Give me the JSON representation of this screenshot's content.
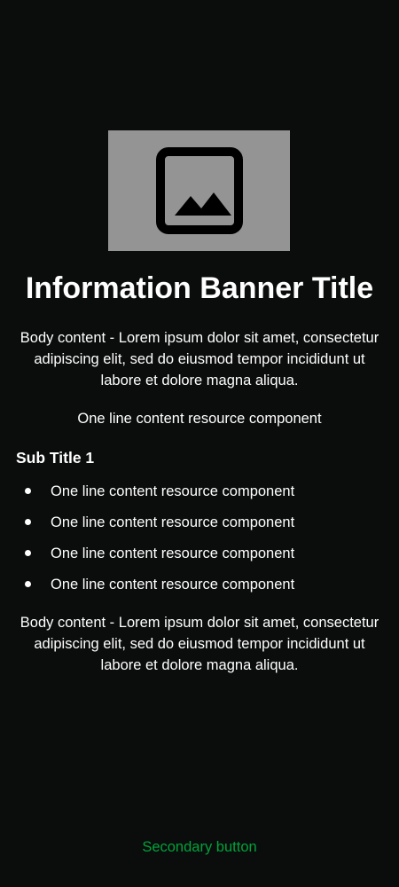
{
  "banner": {
    "image_icon": "image-placeholder-icon",
    "title": "Information Banner Title",
    "body_1": "Body content - Lorem ipsum dolor sit amet, consectetur adipiscing elit, sed do eiusmod tempor incididunt ut labore et dolore magna aliqua.",
    "one_line": "One line content resource component",
    "subtitle": "Sub Title 1",
    "bullets": [
      "One line content resource component",
      "One line content resource component",
      "One line content resource component",
      "One line content resource component"
    ],
    "body_2": "Body content - Lorem ipsum dolor sit amet, consectetur adipiscing elit, sed do eiusmod tempor incididunt ut labore et dolore magna aliqua."
  },
  "actions": {
    "secondary_label": "Secondary button"
  },
  "colors": {
    "background": "#0b0c0c",
    "text": "#ffffff",
    "image_placeholder": "#949494",
    "secondary_button_text": "#00a33b"
  }
}
